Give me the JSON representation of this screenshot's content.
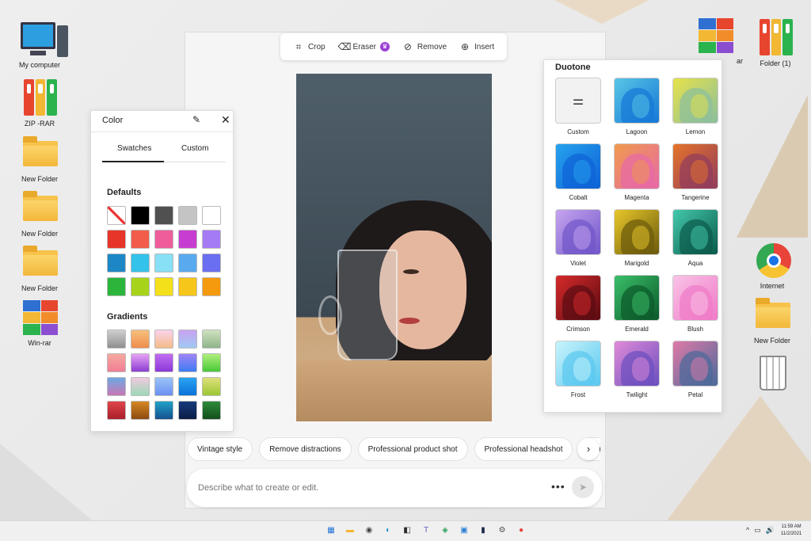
{
  "desktop": {
    "left_icons": [
      {
        "label": "My computer",
        "icon": "computer-icon"
      },
      {
        "label": "ZIP -RAR",
        "icon": "binders-icon"
      },
      {
        "label": "New Folder",
        "icon": "folder-icon"
      },
      {
        "label": "New Folder",
        "icon": "folder-icon"
      },
      {
        "label": "New Folder",
        "icon": "folder-icon"
      },
      {
        "label": "Win-rar",
        "icon": "winrar-icon"
      }
    ],
    "right_icons": [
      {
        "label": "ar",
        "icon": "winrar-icon"
      },
      {
        "label": "Folder (1)",
        "icon": "binders-icon"
      },
      {
        "label": "Internet",
        "icon": "chrome-icon"
      },
      {
        "label": "New Folder",
        "icon": "folder-icon"
      },
      {
        "label": "",
        "icon": "recycle-bin-icon"
      }
    ]
  },
  "toolbar": {
    "crop": "Crop",
    "eraser": "Eraser",
    "remove": "Remove",
    "insert": "Insert"
  },
  "color_panel": {
    "title": "Color",
    "tab_swatches": "Swatches",
    "tab_custom": "Custom",
    "defaults_label": "Defaults",
    "gradients_label": "Gradients",
    "defaults": [
      "none",
      "#000000",
      "#505050",
      "#c4c4c4",
      "#ffffff",
      "#e8352a",
      "#f25c4a",
      "#ef5d9b",
      "#c83dd1",
      "#a57af5",
      "#1d87c6",
      "#33c2ea",
      "#87e0f5",
      "#59a9ef",
      "#6a6ef0",
      "#2bb53b",
      "#a7d41a",
      "#f4e01a",
      "#f6c61a",
      "#f59a0f"
    ],
    "gradients": [
      "linear-gradient(#cfcfcf,#8f8f8f)",
      "linear-gradient(#f7c07b,#ef8d4d)",
      "linear-gradient(#fbd3ec,#f4bb88)",
      "linear-gradient(#c9a2f2,#9fc9f3)",
      "linear-gradient(#cfe2c0,#8fb48a)",
      "linear-gradient(#f6a9a0,#f07e94)",
      "linear-gradient(#e7a1f6,#8c3fd1)",
      "linear-gradient(#c16cf2,#8b39d9)",
      "linear-gradient(#9f84f6,#3f7df3)",
      "linear-gradient(#b0ef7c,#47c937)",
      "linear-gradient(#6fa8e3,#c777b5)",
      "linear-gradient(#f1c8de,#9cd9b9)",
      "linear-gradient(#9ac4f7,#6a8ff1)",
      "linear-gradient(#2aa4f1,#0a72d9)",
      "linear-gradient(#dfe07b,#9bc733)",
      "linear-gradient(#e0454a,#a81f2a)",
      "linear-gradient(#d68722,#8c4a12)",
      "linear-gradient(#1fa2c8,#15508f)",
      "linear-gradient(#173a7a,#0b1d47)",
      "linear-gradient(#2d8a3a,#134f1c)"
    ]
  },
  "duotone": {
    "title": "Duotone",
    "items": [
      {
        "label": "Custom",
        "a": "#f2f2f2",
        "b": "#f2f2f2"
      },
      {
        "label": "Lagoon",
        "a": "#1678d6",
        "b": "#58c6e6"
      },
      {
        "label": "Lemon",
        "a": "#8cbf9c",
        "b": "#e6e24a"
      },
      {
        "label": "Cobalt",
        "a": "#0e62d6",
        "b": "#26a2ee"
      },
      {
        "label": "Magenta",
        "a": "#e76aa6",
        "b": "#f09a4d"
      },
      {
        "label": "Tangerine",
        "a": "#923c5c",
        "b": "#e4732a"
      },
      {
        "label": "Violet",
        "a": "#7056c9",
        "b": "#c6a4ef"
      },
      {
        "label": "Marigold",
        "a": "#6b5a0c",
        "b": "#e8c72a"
      },
      {
        "label": "Aqua",
        "a": "#0b5a4a",
        "b": "#43c9ac"
      },
      {
        "label": "Crimson",
        "a": "#5a0b12",
        "b": "#d62a2a"
      },
      {
        "label": "Emerald",
        "a": "#0b5a2a",
        "b": "#3bbf6a"
      },
      {
        "label": "Blush",
        "a": "#f07ac8",
        "b": "#f9c3e6"
      },
      {
        "label": "Frost",
        "a": "#5ac7f0",
        "b": "#c8f4fb"
      },
      {
        "label": "Twilight",
        "a": "#6b4fbf",
        "b": "#e08ad8"
      },
      {
        "label": "Petal",
        "a": "#4a6a9a",
        "b": "#e07aa8"
      }
    ]
  },
  "suggestions": [
    "Vintage style",
    "Remove distractions",
    "Professional product shot",
    "Professional headshot",
    "Wate"
  ],
  "prompt": {
    "placeholder": "Describe what to create or edit.",
    "more": "•••",
    "send": "➤"
  },
  "taskbar": {
    "apps": [
      {
        "icon": "windows-start-icon",
        "glyph": "▦",
        "color": "#1e6fd9"
      },
      {
        "icon": "file-explorer-icon",
        "glyph": "▬",
        "color": "#f2b733"
      },
      {
        "icon": "camera-icon",
        "glyph": "◉",
        "color": "#444444"
      },
      {
        "icon": "edge-icon",
        "glyph": "◐",
        "color": "#1a8fcf"
      },
      {
        "icon": "store-icon",
        "glyph": "◧",
        "color": "#2b2b2b"
      },
      {
        "icon": "teams-icon",
        "glyph": "T",
        "color": "#5b5fc7"
      },
      {
        "icon": "maps-icon",
        "glyph": "◈",
        "color": "#2aa05a"
      },
      {
        "icon": "files-icon",
        "glyph": "▣",
        "color": "#2a7fd4"
      },
      {
        "icon": "photo-editor-icon",
        "glyph": "▮",
        "color": "#1b2a4a"
      },
      {
        "icon": "settings-icon",
        "glyph": "⚙",
        "color": "#555555"
      },
      {
        "icon": "chrome-icon",
        "glyph": "●",
        "color": "#e8443a"
      }
    ],
    "tray": [
      "^",
      "▭",
      "🔊"
    ],
    "time": "11:59 AM",
    "date": "11/2/2021"
  }
}
